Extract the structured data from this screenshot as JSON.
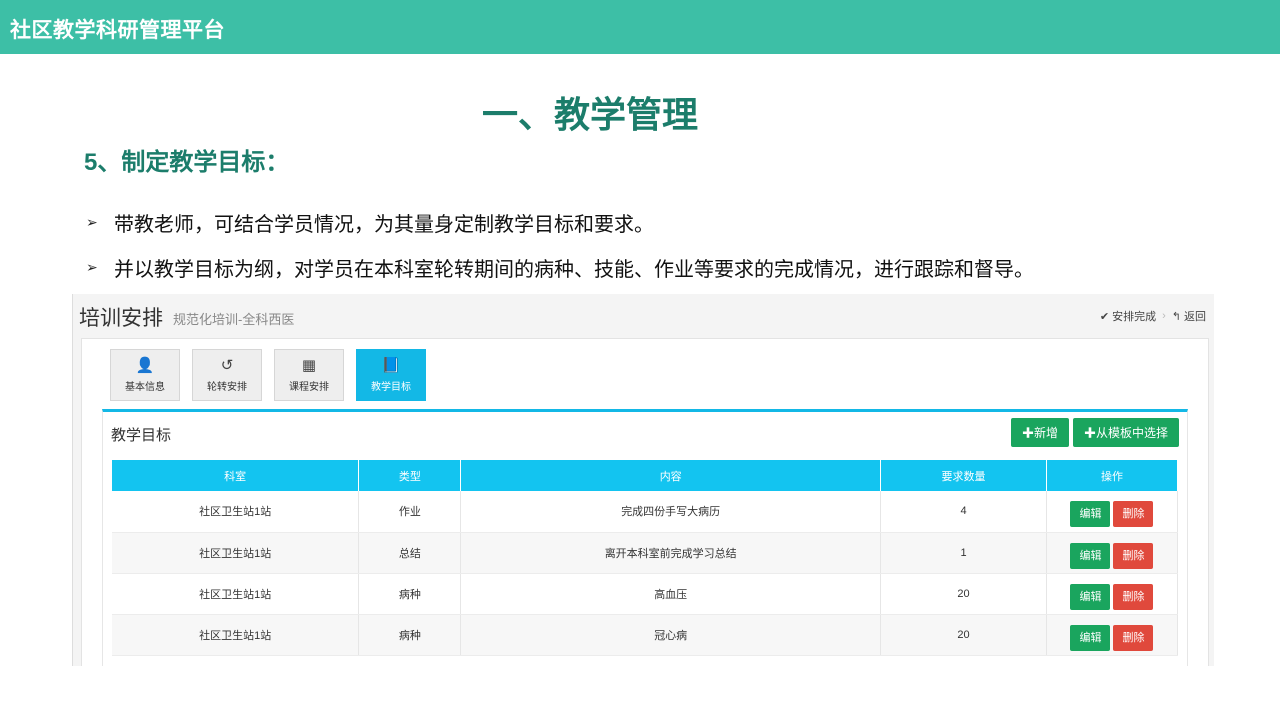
{
  "header": {
    "platform_title": "社区教学科研管理平台"
  },
  "slide": {
    "heading": "一、教学管理",
    "subheading": "5、制定教学目标：",
    "bullets": [
      "带教老师，可结合学员情况，为其量身定制教学目标和要求。",
      "并以教学目标为纲，对学员在本科室轮转期间的病种、技能、作业等要求的完成情况，进行跟踪和督导。"
    ],
    "bullet_marker": "➢"
  },
  "app": {
    "title": "培训安排",
    "subtitle": "规范化培训-全科西医",
    "actions": {
      "complete_icon": "check-icon",
      "complete_label": "安排完成",
      "back_icon": "reply-arrow-icon",
      "back_label": "返回"
    },
    "tabs": [
      {
        "label": "基本信息",
        "icon": "user-icon",
        "glyph": "👤",
        "active": false
      },
      {
        "label": "轮转安排",
        "icon": "history-icon",
        "glyph": "↺",
        "active": false
      },
      {
        "label": "课程安排",
        "icon": "building-icon",
        "glyph": "▦",
        "active": false
      },
      {
        "label": "教学目标",
        "icon": "book-icon",
        "glyph": "📘",
        "active": true
      }
    ],
    "section": {
      "title": "教学目标",
      "add_label": "✚新增",
      "template_label": "✚从模板中选择"
    },
    "table": {
      "columns": [
        "科室",
        "类型",
        "内容",
        "要求数量",
        "操作"
      ],
      "rows": [
        {
          "dept": "社区卫生站1站",
          "type": "作业",
          "content": "完成四份手写大病历",
          "count": "4"
        },
        {
          "dept": "社区卫生站1站",
          "type": "总结",
          "content": "离开本科室前完成学习总结",
          "count": "1"
        },
        {
          "dept": "社区卫生站1站",
          "type": "病种",
          "content": "高血压",
          "count": "20"
        },
        {
          "dept": "社区卫生站1站",
          "type": "病种",
          "content": "冠心病",
          "count": "20"
        }
      ],
      "edit_label": "编辑",
      "delete_label": "删除"
    }
  },
  "colors": {
    "header_bg": "#3dbfa6",
    "heading_text": "#1c7d6b",
    "accent_blue": "#13c4f0",
    "btn_green": "#1aa55e",
    "btn_red": "#e0493c"
  }
}
